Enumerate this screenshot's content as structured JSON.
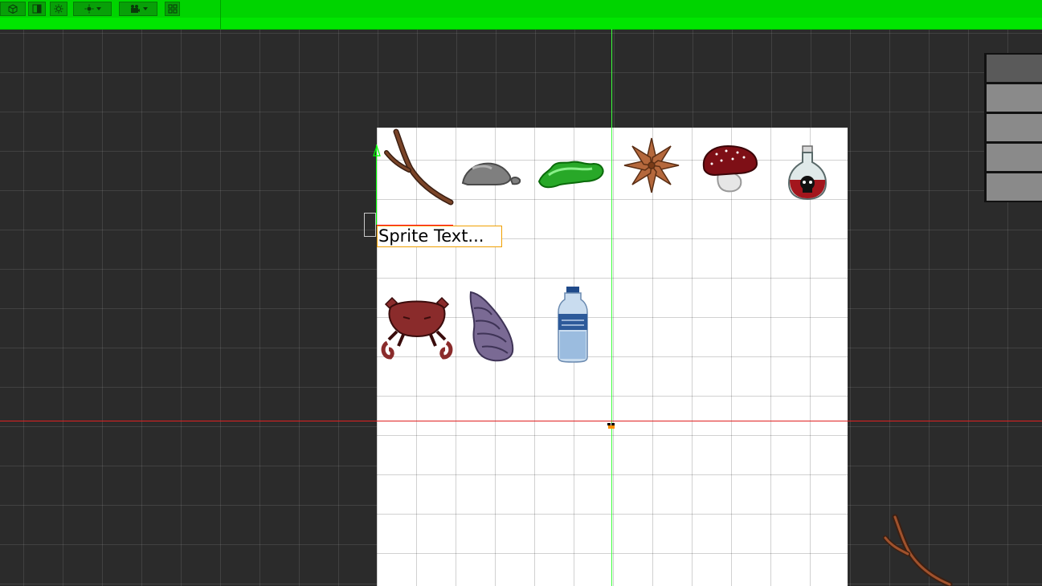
{
  "toolbar": {
    "buttons": [
      {
        "name": "shaded-mode",
        "icon": "cube-icon"
      },
      {
        "name": "2d-toggle",
        "icon": "half-circle-icon"
      },
      {
        "name": "lighting-toggle",
        "icon": "sun-icon"
      },
      {
        "name": "effects-dropdown",
        "icon": "sun-settings-icon"
      },
      {
        "name": "camera-dropdown",
        "icon": "camera-icon"
      },
      {
        "name": "grid-toggle",
        "icon": "grid-icon"
      }
    ],
    "accent_color": "#00e600"
  },
  "scene": {
    "background_color": "#2b2b2b",
    "canvas_color": "#ffffff",
    "axis_colors": {
      "y": "#3cff3c",
      "x": "#e02020"
    },
    "sprites_row1": [
      "stick-sprite",
      "rock-sprite",
      "slime-sprite",
      "star-anise-sprite",
      "mushroom-sprite",
      "poison-bottle-sprite"
    ],
    "sprites_row2": [
      "crab-sprite",
      "shell-sprite",
      "water-bottle-sprite"
    ],
    "selected_text": "Sprite Text..."
  }
}
